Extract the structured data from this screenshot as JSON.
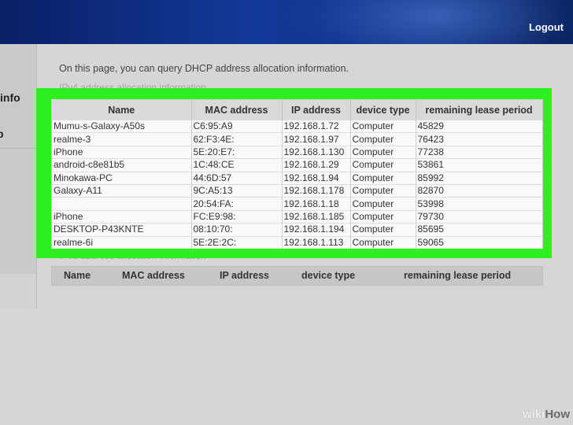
{
  "header": {
    "logout_label": "Logout"
  },
  "sidebar": {
    "item_info": "info",
    "item_p": "p"
  },
  "intro_text": "On this page, you can query DHCP address allocation information.",
  "ipv4_caption": "IPv4 address allocation information",
  "ipv6_caption": "IPv6 address allocation information",
  "ipv4_table": {
    "headers": [
      "Name",
      "MAC address",
      "IP address",
      "device type",
      "remaining lease period"
    ],
    "rows": [
      [
        "Mumu-s-Galaxy-A50s",
        "C6:95:A9",
        "192.168.1.72",
        "Computer",
        "45829"
      ],
      [
        "realme-3",
        "62:F3:4E:",
        "192.168.1.97",
        "Computer",
        "76423"
      ],
      [
        "iPhone",
        "5E:20:E7:",
        "192.168.1.130",
        "Computer",
        "77238"
      ],
      [
        "android-c8e81b5",
        "1C:48:CE",
        "192.168.1.29",
        "Computer",
        "53861"
      ],
      [
        "Minokawa-PC",
        "44:6D:57",
        "192.168.1.94",
        "Computer",
        "85992"
      ],
      [
        "Galaxy-A11",
        "9C:A5:13",
        "192.168.1.178",
        "Computer",
        "82870"
      ],
      [
        "",
        "20:54:FA:",
        "192.168.1.18",
        "Computer",
        "53998"
      ],
      [
        "iPhone",
        "FC:E9:98:",
        "192.168.1.185",
        "Computer",
        "79730"
      ],
      [
        "DESKTOP-P43KNTE",
        "08:10:70:",
        "192.168.1.194",
        "Computer",
        "85695"
      ],
      [
        "realme-6i",
        "5E:2E:2C:",
        "192.168.1.113",
        "Computer",
        "59065"
      ]
    ]
  },
  "ipv6_table": {
    "headers": [
      "Name",
      "MAC address",
      "IP address",
      "device type",
      "remaining lease period"
    ]
  },
  "watermark": {
    "part1": "wiki",
    "part2": "How"
  },
  "colors": {
    "highlight": "#2ff01f",
    "header_blue": "#123a9a"
  }
}
